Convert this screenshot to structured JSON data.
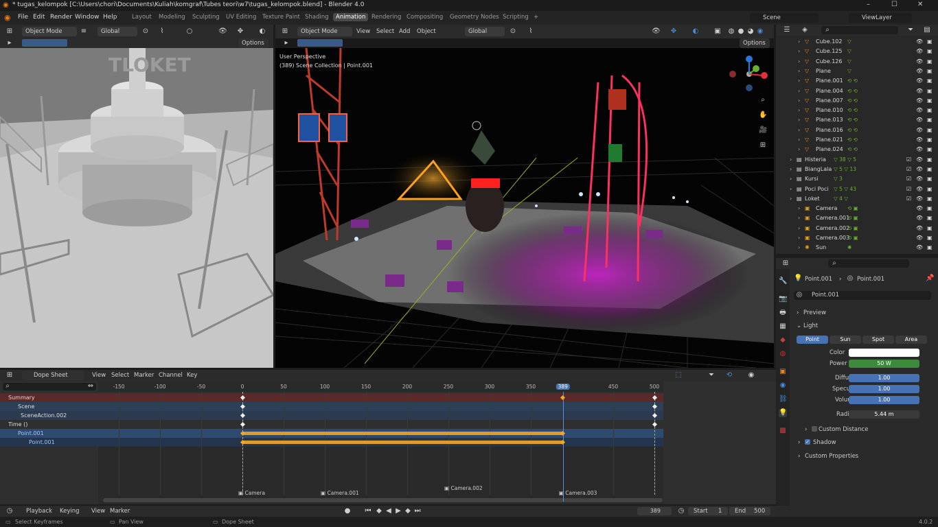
{
  "title_bar": {
    "title": "* tugas_kelompok [C:\\Users\\chori\\Documents\\Kuliah\\komgraf\\Tubes teori\\w7\\tugas_kelompok.blend] - Blender 4.0",
    "minimize": "–",
    "maximize": "☐",
    "close": "✕"
  },
  "menu": {
    "items": [
      "File",
      "Edit",
      "Render",
      "Window",
      "Help"
    ],
    "workspaces": [
      "Layout",
      "Modeling",
      "Sculpting",
      "UV Editing",
      "Texture Paint",
      "Shading",
      "Animation",
      "Rendering",
      "Compositing",
      "Geometry Nodes",
      "Scripting",
      "+"
    ],
    "scene": "Scene",
    "view_layer": "ViewLayer"
  },
  "left_viewport": {
    "mode": "Object Mode",
    "orientation": "Global",
    "options": "Options",
    "sign_text": "TLOKET"
  },
  "right_viewport": {
    "mode": "Object Mode",
    "menus": [
      "View",
      "Select",
      "Add",
      "Object"
    ],
    "orientation": "Global",
    "options": "Options",
    "perspective": "User Perspective",
    "collection": "(389) Scene Collection | Point.001"
  },
  "outliner": {
    "rows": [
      {
        "name": "Cube.102",
        "icons": "▽"
      },
      {
        "name": "Cube.125",
        "icons": "▽"
      },
      {
        "name": "Cube.126",
        "icons": "▽"
      },
      {
        "name": "Plane",
        "icons": "▽"
      },
      {
        "name": "Plane.001",
        "icons": "⟲ ⟲"
      },
      {
        "name": "Plane.004",
        "icons": "⟲ ⟲"
      },
      {
        "name": "Plane.007",
        "icons": "⟲ ⟲"
      },
      {
        "name": "Plane.010",
        "icons": "⟲ ⟲"
      },
      {
        "name": "Plane.013",
        "icons": "⟲ ⟲"
      },
      {
        "name": "Plane.016",
        "icons": "⟲ ⟲"
      },
      {
        "name": "Plane.021",
        "icons": "⟲ ⟲"
      },
      {
        "name": "Plane.024",
        "icons": "⟲ ⟲"
      },
      {
        "name": "Histeria",
        "icons": "▽ 38 ▽ 5"
      },
      {
        "name": "BiangLala",
        "icons": "▽ 5 ▽ 13"
      },
      {
        "name": "Kursi",
        "icons": "▽ 3"
      },
      {
        "name": "Poci Poci",
        "icons": "▽ 5 ▽ 43"
      },
      {
        "name": "Loket",
        "icons": "▽ 4 ▽"
      },
      {
        "name": "Camera",
        "icons": "⟲ ▣"
      },
      {
        "name": "Camera.001",
        "icons": "⟲ ▣"
      },
      {
        "name": "Camera.002",
        "icons": "⟲ ▣"
      },
      {
        "name": "Camera.003",
        "icons": "⟲ ▣"
      },
      {
        "name": "Sun",
        "icons": "✺"
      }
    ]
  },
  "properties": {
    "breadcrumb_obj": "Point.001",
    "breadcrumb_data": "Point.001",
    "datablock": "Point.001",
    "preview": "Preview",
    "light": "Light",
    "light_types": [
      "Point",
      "Sun",
      "Spot",
      "Area"
    ],
    "color_label": "Color",
    "power_label": "Power",
    "power_value": "50 W",
    "diffuse_label": "Diffuse",
    "diffuse_value": "1.00",
    "specular_label": "Specular",
    "specular_value": "1.00",
    "volume_label": "Volume",
    "volume_value": "1.00",
    "radius_label": "Radius",
    "radius_value": "5.44 m",
    "custom_distance": "Custom Distance",
    "shadow": "Shadow",
    "custom_properties": "Custom Properties",
    "colors": {
      "power": "#3c8a3c",
      "slider": "#4772b3",
      "color_swatch": "#ffffff"
    }
  },
  "dope_sheet": {
    "editor": "Dope Sheet",
    "menus": [
      "View",
      "Select",
      "Marker",
      "Channel",
      "Key"
    ],
    "ticks": [
      -150,
      -100,
      -50,
      0,
      50,
      100,
      150,
      200,
      250,
      300,
      350,
      389,
      450,
      500
    ],
    "current_frame": "389",
    "channels": [
      "Summary",
      "Scene",
      "SceneAction.002",
      "Time ()",
      "Point.001",
      "Point.001"
    ],
    "markers": [
      "Camera",
      "Camera.001",
      "Camera.002",
      "Camera.003"
    ],
    "marker_frames": [
      0,
      100,
      250,
      389
    ],
    "keyframes_white": [
      0,
      389,
      500
    ],
    "orange_range": [
      0,
      389
    ]
  },
  "timeline": {
    "menus": [
      "Playback",
      "Keying",
      "View",
      "Marker"
    ],
    "frame": "389",
    "start_label": "Start",
    "start": "1",
    "end_label": "End",
    "end": "500"
  },
  "status_bar": {
    "select": "Select Keyframes",
    "pan": "Pan View",
    "context": "Dope Sheet",
    "version": "4.0.2"
  }
}
